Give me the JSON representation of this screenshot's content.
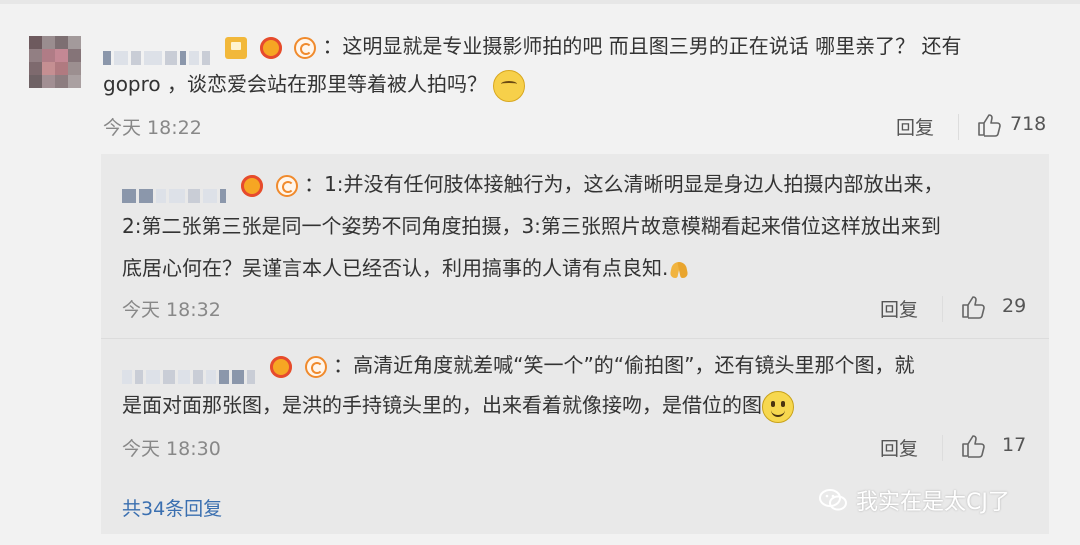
{
  "main_comment": {
    "text_line1": "：这明显就是专业摄影师拍的吧 而且图三男的正在说话 哪里亲了？ 还有",
    "text_line2": "gopro ，谈恋爱会站在那里等着被人拍吗？",
    "emoji": "thinking-face-emoji",
    "time": "今天 18:22",
    "reply_label": "回复",
    "like_count": "718"
  },
  "replies": [
    {
      "text_line1": "：1:并没有任何肢体接触行为，这么清晰明显是身边人拍摄内部放出来，",
      "text_line2": "2:第二张第三张是同一个姿势不同角度拍摄，3:第三张照片故意模糊看起来借位这样放出来到",
      "text_line3": "底居心何在？吴谨言本人已经否认，利用搞事的人请有点良知.",
      "emoji": "folded-hands-emoji",
      "time": "今天 18:32",
      "reply_label": "回复",
      "like_count": "29"
    },
    {
      "text_line1": "：高清近角度就差喊“笑一个”的“偷拍图”，还有镜头里那个图，就",
      "text_line2": "是面对面那张图，是洪的手持镜头里的，出来看着就像接吻，是借位的图",
      "emoji": "smiling-face-emoji",
      "time": "今天 18:30",
      "reply_label": "回复",
      "like_count": "17"
    }
  ],
  "more_replies": "共34条回复",
  "watermark": "我实在是太CJ了",
  "colors": {
    "background": "#f2f2f2",
    "reply_box": "#e9e9e9",
    "link": "#3a6fb0",
    "meta": "#888888"
  }
}
